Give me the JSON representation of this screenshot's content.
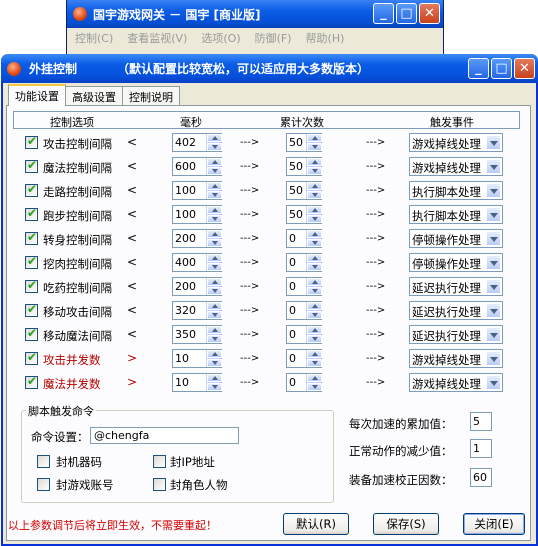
{
  "background_window": {
    "title": "国宇游戏网关 － 国宇 [商业版]",
    "menu": [
      "控制(C)",
      "查看监视(V)",
      "选项(O)",
      "防御(F)",
      "帮助(H)"
    ]
  },
  "window": {
    "title": "外挂控制",
    "subtitle": "（默认配置比较宽松，可以适应用大多数版本）",
    "buttons": {
      "minimize": "_",
      "maximize": "□",
      "close": "✕"
    }
  },
  "tabs": [
    "功能设置",
    "高级设置",
    "控制说明"
  ],
  "table_header": {
    "option": "控制选项",
    "ms": "毫秒",
    "count": "累计次数",
    "event": "触发事件"
  },
  "arrow_text": "--->",
  "rows": [
    {
      "label": "攻击控制间隔",
      "checked": true,
      "ms": "402",
      "count": "50",
      "event": "游戏掉线处理",
      "red": false
    },
    {
      "label": "魔法控制间隔",
      "checked": true,
      "ms": "600",
      "count": "50",
      "event": "游戏掉线处理",
      "red": false
    },
    {
      "label": "走路控制间隔",
      "checked": true,
      "ms": "100",
      "count": "50",
      "event": "执行脚本处理",
      "red": false
    },
    {
      "label": "跑步控制间隔",
      "checked": true,
      "ms": "100",
      "count": "50",
      "event": "执行脚本处理",
      "red": false
    },
    {
      "label": "转身控制间隔",
      "checked": true,
      "ms": "200",
      "count": "0",
      "event": "停顿操作处理",
      "red": false
    },
    {
      "label": "挖肉控制间隔",
      "checked": true,
      "ms": "400",
      "count": "0",
      "event": "停顿操作处理",
      "red": false
    },
    {
      "label": "吃药控制间隔",
      "checked": true,
      "ms": "200",
      "count": "0",
      "event": "延迟执行处理",
      "red": false
    },
    {
      "label": "移动攻击间隔",
      "checked": true,
      "ms": "320",
      "count": "0",
      "event": "延迟执行处理",
      "red": false
    },
    {
      "label": "移动魔法间隔",
      "checked": true,
      "ms": "350",
      "count": "0",
      "event": "延迟执行处理",
      "red": false
    },
    {
      "label": "攻击并发数",
      "checked": true,
      "ms": "10",
      "count": "0",
      "event": "游戏掉线处理",
      "red": true
    },
    {
      "label": "魔法并发数",
      "checked": true,
      "ms": "10",
      "count": "0",
      "event": "游戏掉线处理",
      "red": true
    }
  ],
  "script_group": {
    "title": "脚本触发命令",
    "command_label": "命令设置：",
    "command_value": "@chengfa",
    "options": [
      "封机器码",
      "封IP地址",
      "封游戏账号",
      "封角色人物"
    ]
  },
  "right_settings": [
    {
      "label": "每次加速的累加值：",
      "value": "5"
    },
    {
      "label": "正常动作的减少值：",
      "value": "1"
    },
    {
      "label": "装备加速校正因数：",
      "value": "60"
    }
  ],
  "note": "以上参数调节后将立即生效，不需要重起！",
  "footer_buttons": {
    "default": "默认(R)",
    "save": "保存(S)",
    "close": "关闭(E)"
  }
}
